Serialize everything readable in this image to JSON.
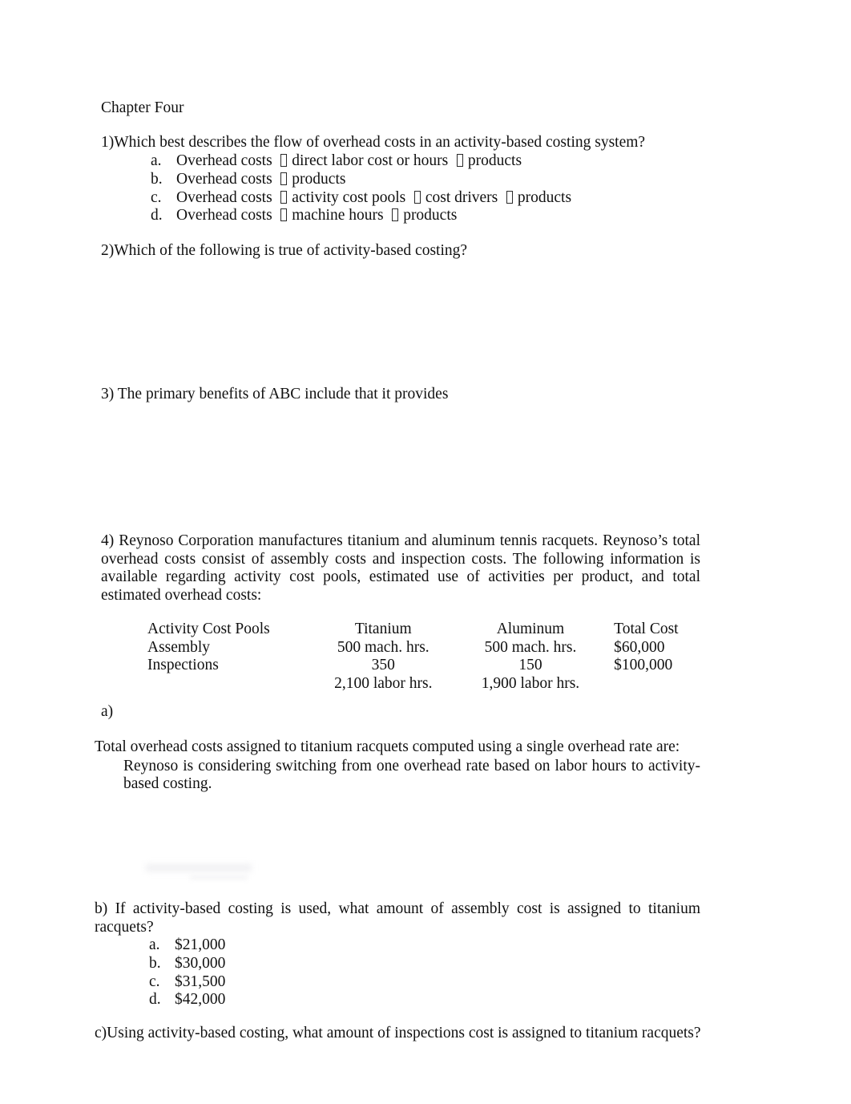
{
  "document": {
    "chapter_title": "Chapter Four",
    "arrow_glyph": "⎕"
  },
  "questions": {
    "q1": {
      "stem": "1)Which best describes the flow of overhead costs in an activity-based costing system?",
      "options": [
        {
          "label": "a.",
          "parts": [
            "Overhead costs",
            "direct labor cost or hours",
            "products"
          ],
          "highlighted": false
        },
        {
          "label": "b.",
          "parts": [
            "Overhead costs",
            "products"
          ],
          "highlighted": false
        },
        {
          "label": "c.",
          "parts": [
            "Overhead costs",
            "activity cost pools",
            "cost drivers",
            "products"
          ],
          "highlighted": true
        },
        {
          "label": "d.",
          "parts": [
            "Overhead costs",
            "machine hours",
            "products"
          ],
          "highlighted": false
        }
      ]
    },
    "q2": {
      "stem": "2)Which of the following is true of activity-based costing?"
    },
    "q3": {
      "stem": "3) The primary benefits of ABC include that it provides"
    },
    "q4": {
      "stem": "4) Reynoso Corporation manufactures titanium and aluminum tennis racquets. Reynoso’s total overhead costs consist of assembly costs and inspection costs. The following information is available regarding activity cost pools, estimated use of activities per product, and total estimated overhead costs:",
      "part_a": {
        "marker": "a)",
        "text": "Reynoso is considering switching from one overhead rate based on labor hours to activity-based costing.",
        "line2": "Total overhead costs assigned to titanium racquets computed using a single overhead rate are:"
      },
      "part_b": {
        "stem": "b) If activity-based costing is used, what amount of assembly cost is assigned to titanium racquets?",
        "options": [
          {
            "label": "a.",
            "value": "$21,000",
            "highlighted": false
          },
          {
            "label": "b.",
            "value": "$30,000",
            "highlighted": true
          },
          {
            "label": "c.",
            "value": "$31,500",
            "highlighted": false
          },
          {
            "label": "d.",
            "value": "$42,000",
            "highlighted": false
          }
        ]
      },
      "part_c": {
        "stem": "c)Using activity-based costing, what amount of inspections cost is assigned to titanium racquets?"
      }
    }
  },
  "cost_table": {
    "headers": [
      "Activity Cost Pools",
      "Titanium",
      "Aluminum",
      "Total Cost"
    ],
    "rows": [
      {
        "pool": "Assembly",
        "titanium": "500 mach. hrs.",
        "aluminum": "500 mach. hrs.",
        "total_cost": "$60,000"
      },
      {
        "pool": "Inspections",
        "titanium": "350",
        "aluminum": "150",
        "total_cost": "$100,000"
      },
      {
        "pool": "",
        "titanium": "2,100 labor hrs.",
        "aluminum": "1,900 labor hrs.",
        "total_cost": ""
      }
    ]
  },
  "colors": {
    "highlight": "#ffff00",
    "text": "#111111",
    "page_background": "#ffffff"
  }
}
